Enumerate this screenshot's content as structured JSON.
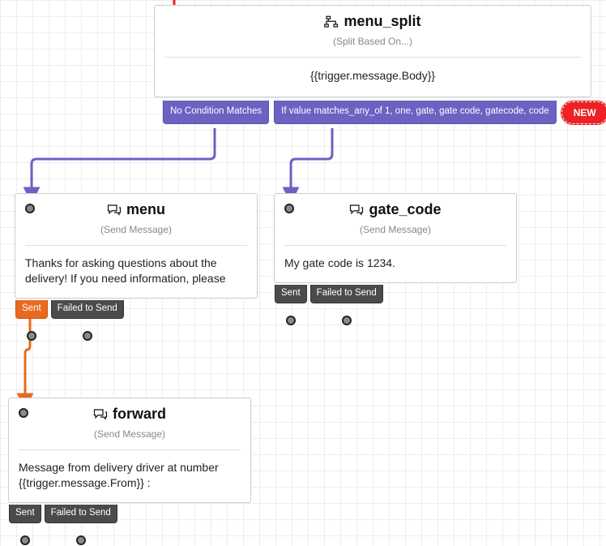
{
  "split": {
    "title": "menu_split",
    "subtitle": "(Split Based On...)",
    "expression": "{{trigger.message.Body}}",
    "no_match_label": "No Condition Matches",
    "condition_label": "If value matches_any_of 1, one, gate, gate code, gatecode, code",
    "new_label": "NEW"
  },
  "menu": {
    "title": "menu",
    "subtitle": "(Send Message)",
    "body": "Thanks for asking questions about the delivery! If you need information, please",
    "sent_label": "Sent",
    "failed_label": "Failed to Send"
  },
  "gate_code": {
    "title": "gate_code",
    "subtitle": "(Send Message)",
    "body": "My gate code is 1234.",
    "sent_label": "Sent",
    "failed_label": "Failed to Send"
  },
  "forward": {
    "title": "forward",
    "subtitle": "(Send Message)",
    "body": "Message from delivery driver at number {{trigger.message.From}} :",
    "sent_label": "Sent",
    "failed_label": "Failed to Send"
  }
}
